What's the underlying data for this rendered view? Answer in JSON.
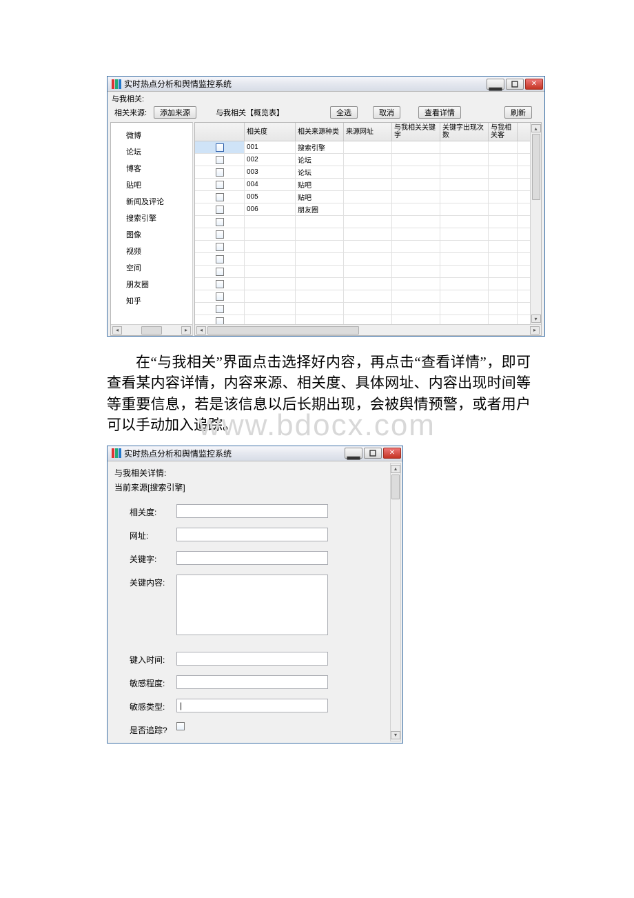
{
  "app_title": "实时热点分析和舆情监控系统",
  "watermark": "www.bdocx.com",
  "window1": {
    "header_label": "与我相关:",
    "sources_label": "相关来源:",
    "add_source_btn": "添加来源",
    "overview_label": "与我相关【概览表】",
    "select_all_btn": "全选",
    "cancel_btn": "取消",
    "view_detail_btn": "查看详情",
    "refresh_btn": "刷新",
    "sidebar_items": [
      "微博",
      "论坛",
      "博客",
      "贴吧",
      "新闻及评论",
      "搜索引擎",
      "图像",
      "视频",
      "空间",
      "朋友圈",
      "知乎"
    ],
    "columns": [
      "",
      "相关度",
      "相关来源种类",
      "来源网址",
      "与我相关关键字",
      "关键字出现次数",
      "与我相关客"
    ],
    "rows": [
      {
        "sel": true,
        "relevance": "001",
        "source_type": "搜索引擎"
      },
      {
        "sel": false,
        "relevance": "002",
        "source_type": "论坛"
      },
      {
        "sel": false,
        "relevance": "003",
        "source_type": "论坛"
      },
      {
        "sel": false,
        "relevance": "004",
        "source_type": "贴吧"
      },
      {
        "sel": false,
        "relevance": "005",
        "source_type": "贴吧"
      },
      {
        "sel": false,
        "relevance": "006",
        "source_type": "朋友圈"
      },
      {
        "sel": false,
        "relevance": "",
        "source_type": ""
      },
      {
        "sel": false,
        "relevance": "",
        "source_type": ""
      },
      {
        "sel": false,
        "relevance": "",
        "source_type": ""
      },
      {
        "sel": false,
        "relevance": "",
        "source_type": ""
      },
      {
        "sel": false,
        "relevance": "",
        "source_type": ""
      },
      {
        "sel": false,
        "relevance": "",
        "source_type": ""
      },
      {
        "sel": false,
        "relevance": "",
        "source_type": ""
      },
      {
        "sel": false,
        "relevance": "",
        "source_type": ""
      },
      {
        "sel": false,
        "relevance": "",
        "source_type": ""
      }
    ]
  },
  "paragraph": "在“与我相关”界面点击选择好内容，再点击“查看详情”，即可查看某内容详情，内容来源、相关度、具体网址、内容出现时间等等重要信息，若是该信息以后长期出现，会被舆情预警，或者用户可以手动加入追踪。",
  "window2": {
    "heading": "与我相关详情:",
    "current_source": "当前来源[搜索引擎]",
    "fields": {
      "relevance_label": "相关度:",
      "url_label": "网址:",
      "keyword_label": "关键字:",
      "key_content_label": "关键内容:",
      "input_time_label": "键入时间:",
      "sensitivity_degree_label": "敏感程度:",
      "sensitivity_type_label": "敏感类型:",
      "track_label": "是否追踪?"
    },
    "values": {
      "relevance": "",
      "url": "",
      "keyword": "",
      "key_content": "",
      "input_time": "",
      "sensitivity_degree": "",
      "sensitivity_type": "|",
      "track_checked": false
    }
  }
}
